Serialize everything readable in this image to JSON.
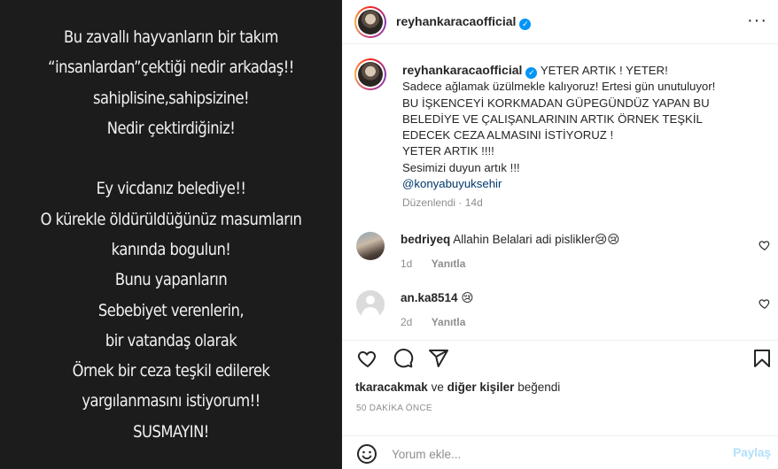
{
  "media": {
    "lines": [
      "Bu zavallı hayvanların bir takım",
      "“insanlardan”çektiği nedir arkadaş!!",
      "sahiplisine,sahipsizine!",
      "Nedir çektirdiğiniz!",
      "",
      "Ey vicdanız belediye!!",
      "O kürekle öldürüldüğünüz masumların",
      "kanında bogulun!",
      "Bunu yapanların",
      "Sebebiyet verenlerin,",
      "bir vatandaş olarak",
      "Örnek bir ceza teşkil edilerek",
      "yargılanmasını istiyorum!!",
      "SUSMAYIN!"
    ]
  },
  "header": {
    "username": "reyhankaracaofficial",
    "more_icon": "more-horizontal-icon",
    "more_glyph": "···"
  },
  "caption": {
    "username": "reyhankaracaofficial",
    "first_line": "YETER ARTIK ! YETER!",
    "lines": [
      "Sadece ağlamak üzülmekle kalıyoruz! Ertesi gün unutuluyor!",
      "BU İŞKENCEYİ KORKMADAN GÜPEGÜNDÜZ YAPAN BU",
      "BELEDİYE VE ÇALIŞANLARININ ARTIK ÖRNEK TEŞKİL",
      "EDECEK CEZA ALMASINI İSTİYORUZ !",
      "YETER ARTIK !!!!",
      "Sesimizi duyun artık !!!"
    ],
    "mention": "@konyabuyuksehir",
    "edited_label": "Düzenlendi",
    "separator": "·",
    "age": "14d"
  },
  "comments": [
    {
      "username": "bedriyeq",
      "text": "Allahin Belalari adi pislikler😢😢",
      "age": "1d",
      "reply": "Yanıtla"
    },
    {
      "username": "an.ka8514",
      "text": "😢",
      "age": "2d",
      "reply": "Yanıtla"
    }
  ],
  "actions": {
    "icons": [
      "heart-icon",
      "comment-icon",
      "share-icon",
      "bookmark-icon"
    ]
  },
  "likes": {
    "user": "tkaracakmak",
    "conjunction": "ve",
    "others": "diğer kişiler",
    "verb": "beğendi"
  },
  "timestamp": "50 DAKİKA ÖNCE",
  "comment_box": {
    "placeholder": "Yorum ekle...",
    "submit_label": "Paylaş"
  },
  "colors": {
    "link": "#00376b",
    "verified": "#0095f6",
    "muted": "#8e8e8e",
    "share_disabled": "#b2dffc",
    "media_bg": "#1c1c1c"
  }
}
